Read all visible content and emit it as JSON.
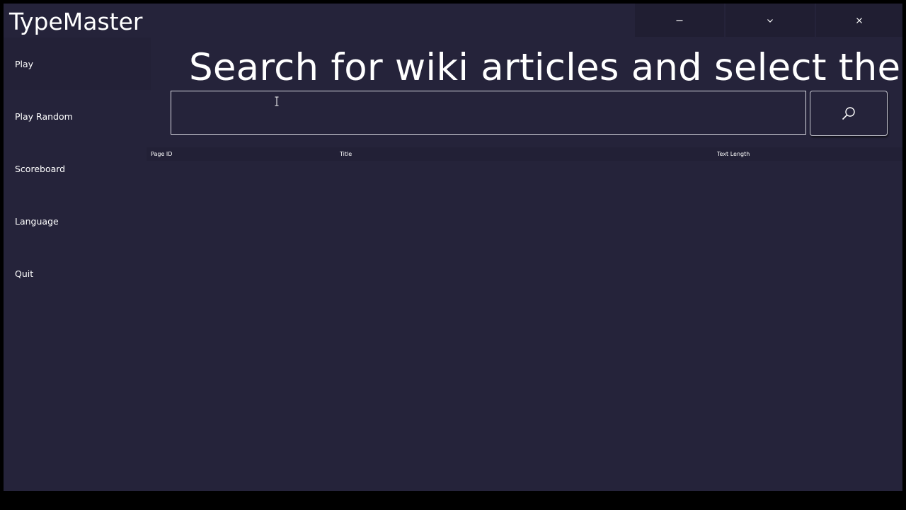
{
  "app": {
    "title": "TypeMaster"
  },
  "window_controls": {
    "minimize": "minimize-icon",
    "maximize": "chevron-down-icon",
    "close": "close-icon"
  },
  "sidebar": {
    "items": [
      {
        "label": "Play",
        "active": true
      },
      {
        "label": "Play Random",
        "active": false
      },
      {
        "label": "Scoreboard",
        "active": false
      },
      {
        "label": "Language",
        "active": false
      },
      {
        "label": "Quit",
        "active": false
      }
    ]
  },
  "main": {
    "heading": "Search for wiki articles and select them",
    "search": {
      "value": "",
      "placeholder": "",
      "button_icon": "search-icon"
    },
    "table": {
      "columns": [
        "Page ID",
        "Title",
        "Text Length"
      ],
      "rows": []
    }
  },
  "colors": {
    "window_bg": "#25233a",
    "outer_bg": "#000000",
    "text": "#ffffff"
  }
}
